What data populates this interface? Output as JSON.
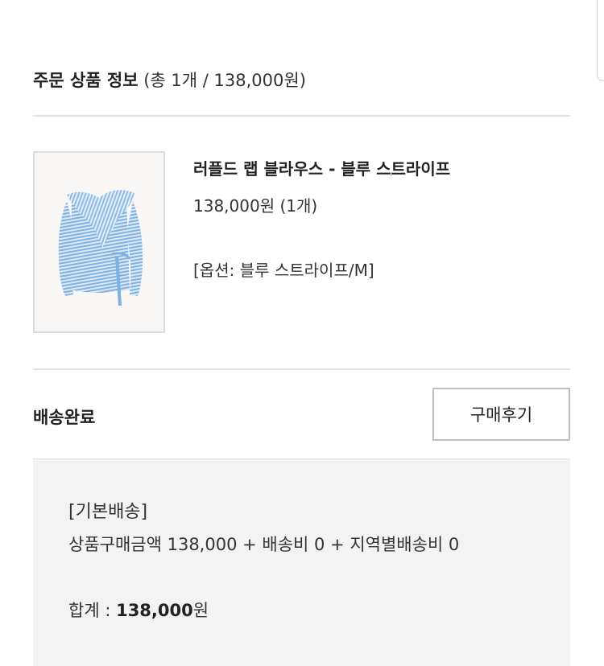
{
  "order_info": {
    "title": "주문 상품 정보",
    "summary": "(총 1개 / 138,000원)"
  },
  "product": {
    "image_icon": "striped-ruffled-blouse-image",
    "name": "러플드 랩 블라우스 - 블루 스트라이프",
    "price": "138,000원 (1개)",
    "option": "[옵션: 블루 스트라이프/M]"
  },
  "delivery": {
    "status": "배송완료",
    "review_button_label": "구매후기"
  },
  "shipping": {
    "type": "[기본배송]",
    "breakdown": "상품구매금액 138,000 + 배송비 0 + 지역별배송비 0",
    "total_label": "합계 : ",
    "total_amount": "138,000",
    "total_unit": "원"
  },
  "colors": {
    "divider": "#e3e3e3",
    "box_background": "#f3f3f3",
    "button_border": "#bdbdbd",
    "stripe_blue": "#7fb1e0"
  }
}
